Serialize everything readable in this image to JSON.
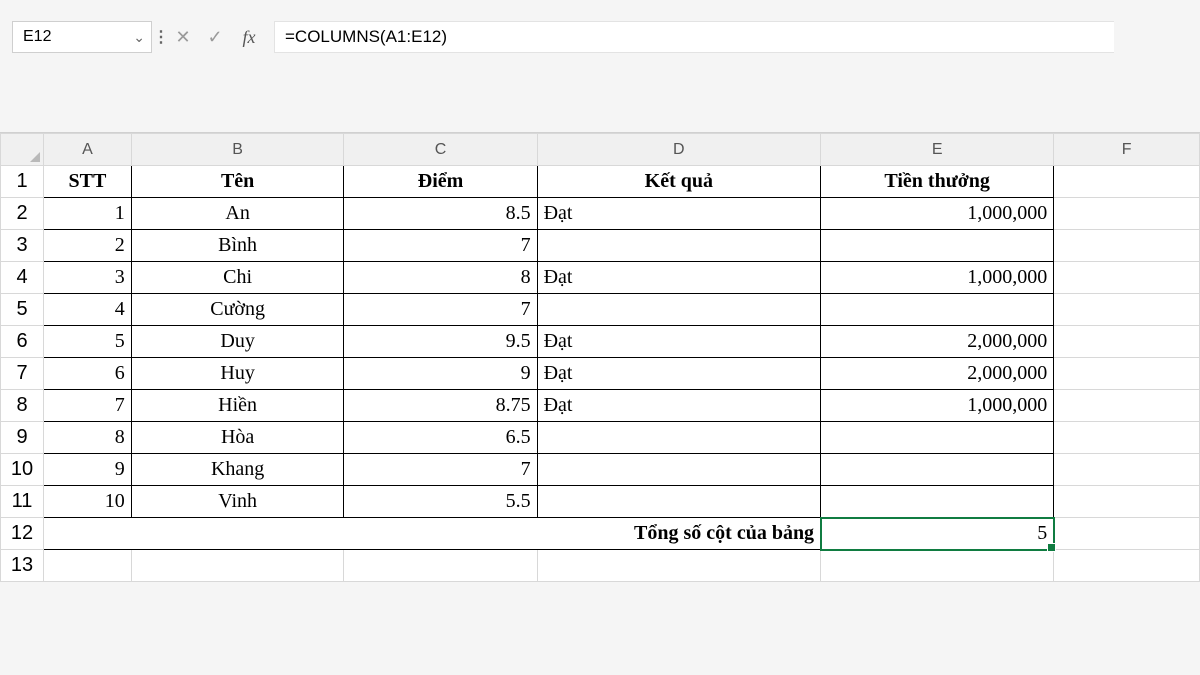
{
  "name_box": "E12",
  "formula": "=COLUMNS(A1:E12)",
  "col_headers": [
    "A",
    "B",
    "C",
    "D",
    "E",
    "F"
  ],
  "row_nums": [
    "1",
    "2",
    "3",
    "4",
    "5",
    "6",
    "7",
    "8",
    "9",
    "10",
    "11",
    "12",
    "13"
  ],
  "headers": {
    "a": "STT",
    "b": "Tên",
    "c": "Điểm",
    "d": "Kết quả",
    "e": "Tiền thưởng"
  },
  "rows": [
    {
      "stt": "1",
      "ten": "An",
      "diem": "8.5",
      "kq": "Đạt",
      "tien": "1,000,000"
    },
    {
      "stt": "2",
      "ten": "Bình",
      "diem": "7",
      "kq": "",
      "tien": ""
    },
    {
      "stt": "3",
      "ten": "Chi",
      "diem": "8",
      "kq": "Đạt",
      "tien": "1,000,000"
    },
    {
      "stt": "4",
      "ten": "Cường",
      "diem": "7",
      "kq": "",
      "tien": ""
    },
    {
      "stt": "5",
      "ten": "Duy",
      "diem": "9.5",
      "kq": "Đạt",
      "tien": "2,000,000"
    },
    {
      "stt": "6",
      "ten": "Huy",
      "diem": "9",
      "kq": "Đạt",
      "tien": "2,000,000"
    },
    {
      "stt": "7",
      "ten": "Hiền",
      "diem": "8.75",
      "kq": "Đạt",
      "tien": "1,000,000"
    },
    {
      "stt": "8",
      "ten": "Hòa",
      "diem": "6.5",
      "kq": "",
      "tien": ""
    },
    {
      "stt": "9",
      "ten": "Khang",
      "diem": "7",
      "kq": "",
      "tien": ""
    },
    {
      "stt": "10",
      "ten": "Vinh",
      "diem": "5.5",
      "kq": "",
      "tien": ""
    }
  ],
  "summary": {
    "label": "Tổng số cột của bảng",
    "value": "5"
  }
}
